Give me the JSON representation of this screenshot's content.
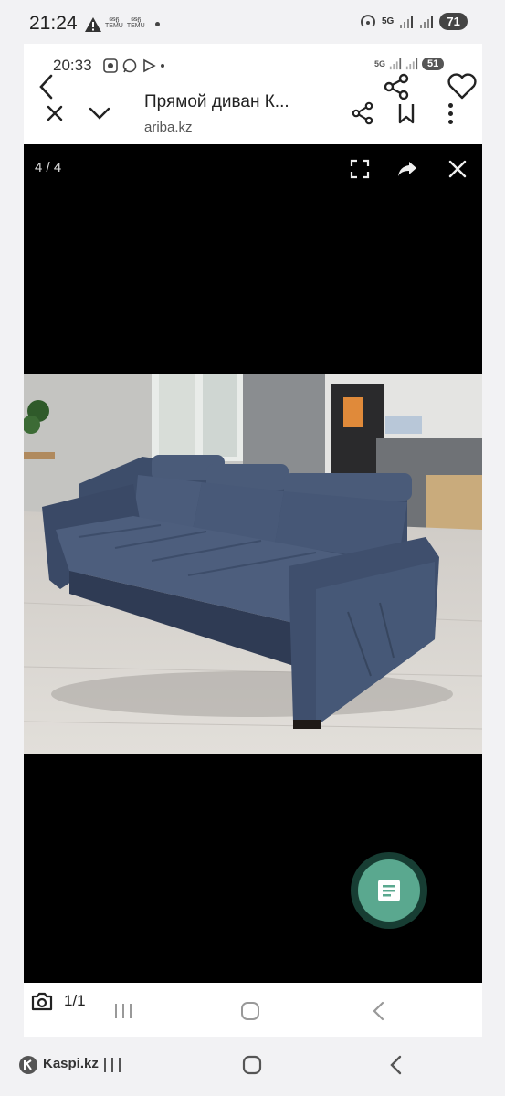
{
  "status_bar": {
    "time": "21:24",
    "temu_label_1": "TEMU",
    "temu_label_2": "TEMU",
    "network": "5G",
    "battery": "71"
  },
  "inner_status_bar": {
    "time": "20:33",
    "network": "5G",
    "battery": "51"
  },
  "browser": {
    "title": "Прямой диван К...",
    "url": "ariba.kz"
  },
  "viewer": {
    "counter": "4 / 4"
  },
  "bottom": {
    "photo_count": "1/1",
    "app_label": "Kaspi.kz"
  },
  "colors": {
    "fab": "#5aa88f",
    "sofa": "#3f4f6b"
  }
}
